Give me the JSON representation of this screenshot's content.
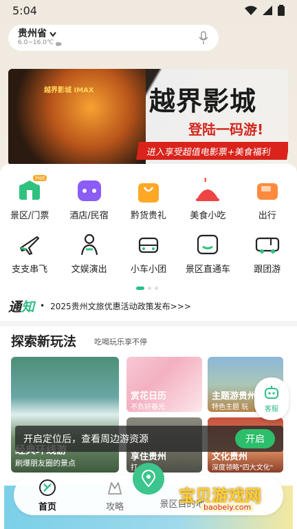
{
  "status_bar": {
    "time": "5:04"
  },
  "location": {
    "name": "贵州省",
    "temperature": "6.0~16.0℃"
  },
  "banner": {
    "brand": "越界影城 IMAX",
    "title": "越界影城",
    "subtitle": "登陆一码游!",
    "strip": "进入享受超值电影票+美食福利"
  },
  "grid": {
    "row1": [
      {
        "label": "景区/门票",
        "icon": "scenic-ticket-icon",
        "badge": "Hot"
      },
      {
        "label": "酒店/民宿",
        "icon": "hotel-icon"
      },
      {
        "label": "黔货贵礼",
        "icon": "gift-bag-icon"
      },
      {
        "label": "美食小吃",
        "icon": "food-cloche-icon"
      },
      {
        "label": "出行",
        "icon": "travel-icon"
      }
    ],
    "row2": [
      {
        "label": "支支串飞",
        "icon": "plane-icon"
      },
      {
        "label": "文娱演出",
        "icon": "performer-icon"
      },
      {
        "label": "小车小团",
        "icon": "car-icon"
      },
      {
        "label": "景区直通车",
        "icon": "shuttle-icon"
      },
      {
        "label": "跟团游",
        "icon": "van-icon"
      }
    ]
  },
  "notice": {
    "logo_a": "通",
    "logo_b": "知",
    "text": "2025贵州文旅优惠活动政策发布>>>"
  },
  "section": {
    "title": "探索新玩法",
    "subtitle": "吃喝玩乐享不停"
  },
  "tiles": {
    "big": {
      "title": "经典环线游",
      "subtitle": "刷爆朋友圈的景点"
    },
    "t1": {
      "title": "赏花日历",
      "subtitle": "不负好春光"
    },
    "t2": {
      "title": "主题游贵州",
      "subtitle": "特色主题 玩"
    },
    "t3": {
      "title": "享住贵州",
      "subtitle": "打"
    },
    "t4": {
      "title": "文化贵州",
      "subtitle": "深度领略\"四大文化\""
    }
  },
  "locate_prompt": {
    "text": "开启定位后，查看周边游资源",
    "button": "开启"
  },
  "kefu": {
    "label": "客服"
  },
  "bottom_nav": [
    {
      "label": "首页",
      "icon": "home-icon",
      "active": true
    },
    {
      "label": "攻略",
      "icon": "guide-icon",
      "active": false
    },
    {
      "label": "景区目的地",
      "icon": "destination-icon",
      "active": false
    }
  ],
  "watermark": {
    "text": "宝贝游戏网",
    "url": "baobeiy.com"
  },
  "colors": {
    "accent": "#2dbe86",
    "banner_red": "#d9231b",
    "locate_green": "#2dbe6b"
  }
}
